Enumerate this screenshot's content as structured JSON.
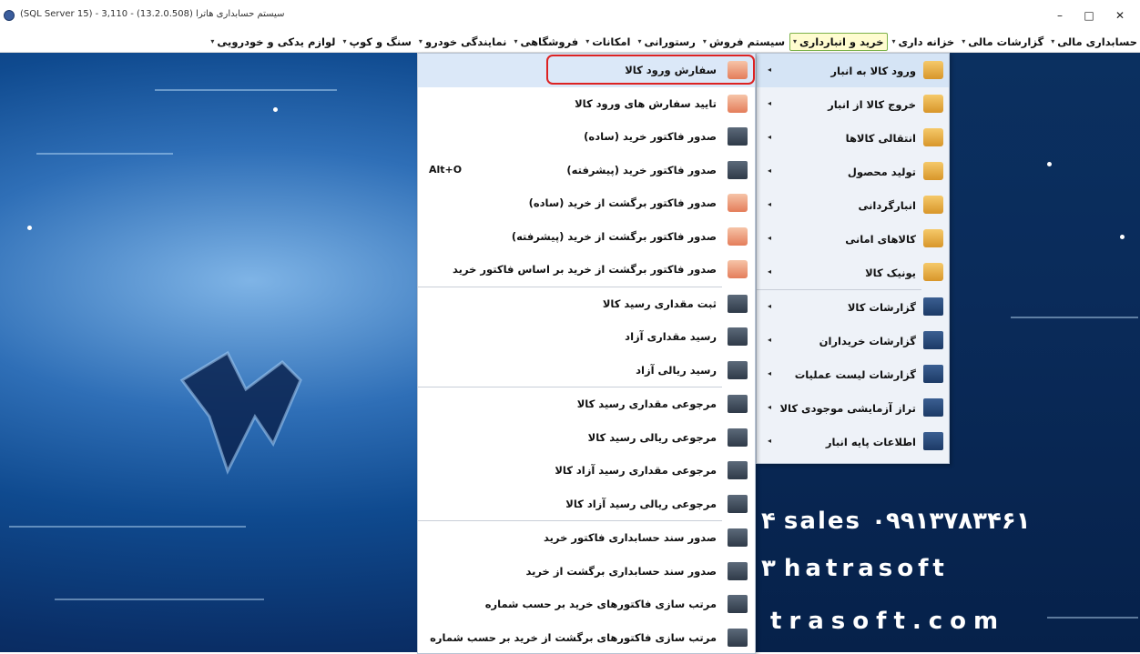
{
  "window": {
    "title": "(SQL Server 15) - 3,110 - (13.2.0.508) سیستم حسابداری هاترا",
    "minimize": "–",
    "maximize": "□",
    "close": "✕"
  },
  "menubar": {
    "items": [
      {
        "label": "حسابداری مالی"
      },
      {
        "label": "گزارشات مالی"
      },
      {
        "label": "خزانه داری"
      },
      {
        "label": "خرید و انبارداری"
      },
      {
        "label": "سیستم فروش"
      },
      {
        "label": "رستورانی"
      },
      {
        "label": "امکانات"
      },
      {
        "label": "فروشگاهی"
      },
      {
        "label": "نمایندگی خودرو"
      },
      {
        "label": "سنگ و کوپ"
      },
      {
        "label": "لوازم یدکی و خودرویی"
      }
    ]
  },
  "submenu_level1": {
    "items": [
      {
        "label": "ورود کالا به انبار",
        "icon": "box-in-icon"
      },
      {
        "label": "خروج کالا از انبار",
        "icon": "box-out-icon"
      },
      {
        "label": "انتقالی کالاها",
        "icon": "warehouse-transfer-icon"
      },
      {
        "label": "تولید محصول",
        "icon": "production-icon"
      },
      {
        "label": "انبارگردانی",
        "icon": "inventory-count-icon"
      },
      {
        "label": "کالاهای امانی",
        "icon": "consignment-icon"
      },
      {
        "label": "یونیک کالا",
        "icon": "unique-item-icon"
      },
      {
        "label": "گزارشات کالا",
        "icon": "item-reports-icon"
      },
      {
        "label": "گزارشات خریداران",
        "icon": "buyer-reports-icon"
      },
      {
        "label": "گزارشات لیست عملیات",
        "icon": "operations-reports-icon"
      },
      {
        "label": "تراز آزمایشی موجودی کالا",
        "icon": "trial-balance-icon"
      },
      {
        "label": "اطلاعات پایه انبار",
        "icon": "warehouse-base-info-icon"
      }
    ]
  },
  "submenu_level2": {
    "items": [
      {
        "label": "سفارش ورود کالا",
        "icon": "cart-order-icon",
        "shortcut": ""
      },
      {
        "label": "تایید سفارش های ورود کالا",
        "icon": "cart-check-icon",
        "shortcut": ""
      },
      {
        "label": "صدور فاکتور خرید (ساده)",
        "icon": "invoice-icon",
        "shortcut": ""
      },
      {
        "label": "صدور فاکتور خرید (پیشرفته)",
        "icon": "invoice-advanced-icon",
        "shortcut": "Alt+O"
      },
      {
        "label": "صدور فاکتور برگشت از خرید (ساده)",
        "icon": "cart-return-icon",
        "shortcut": ""
      },
      {
        "label": "صدور فاکتور برگشت از خرید (پیشرفته)",
        "icon": "cart-return-advanced-icon",
        "shortcut": ""
      },
      {
        "label": "صدور فاکتور برگشت از خرید بر اساس فاکتور خرید",
        "icon": "cart-return-by-invoice-icon",
        "shortcut": ""
      },
      {
        "label": "ثبت مقداری رسید کالا",
        "icon": "receipt-quantity-icon",
        "shortcut": ""
      },
      {
        "label": "رسید مقداری آزاد",
        "icon": "receipt-free-quantity-icon",
        "shortcut": ""
      },
      {
        "label": "رسید ریالی آزاد",
        "icon": "receipt-free-rial-icon",
        "shortcut": ""
      },
      {
        "label": "مرجوعی مقداری رسید کالا",
        "icon": "return-quantity-icon",
        "shortcut": ""
      },
      {
        "label": "مرجوعی ریالی رسید کالا",
        "icon": "return-rial-icon",
        "shortcut": ""
      },
      {
        "label": "مرجوعی مقداری رسید آزاد کالا",
        "icon": "return-free-quantity-icon",
        "shortcut": ""
      },
      {
        "label": "مرجوعی ریالی رسید آزاد کالا",
        "icon": "return-free-rial-icon",
        "shortcut": ""
      },
      {
        "label": "صدور سند حسابداری فاکتور خرید",
        "icon": "accounting-doc-icon",
        "shortcut": ""
      },
      {
        "label": "صدور سند حسابداری برگشت از خرید",
        "icon": "accounting-return-doc-icon",
        "shortcut": ""
      },
      {
        "label": "مرتب سازی فاکتورهای خرید بر حسب شماره",
        "icon": "sort-invoices-icon",
        "shortcut": ""
      },
      {
        "label": "مرتب سازی فاکتورهای برگشت از خرید بر حسب شماره",
        "icon": "sort-return-invoices-icon",
        "shortcut": ""
      }
    ]
  },
  "background": {
    "phone_line": "۴ sales ۰۹۹۱۳۷۸۳۴۶۱",
    "instagram_line": "۳ hatrasoft",
    "web_line": "trasoft.com"
  }
}
